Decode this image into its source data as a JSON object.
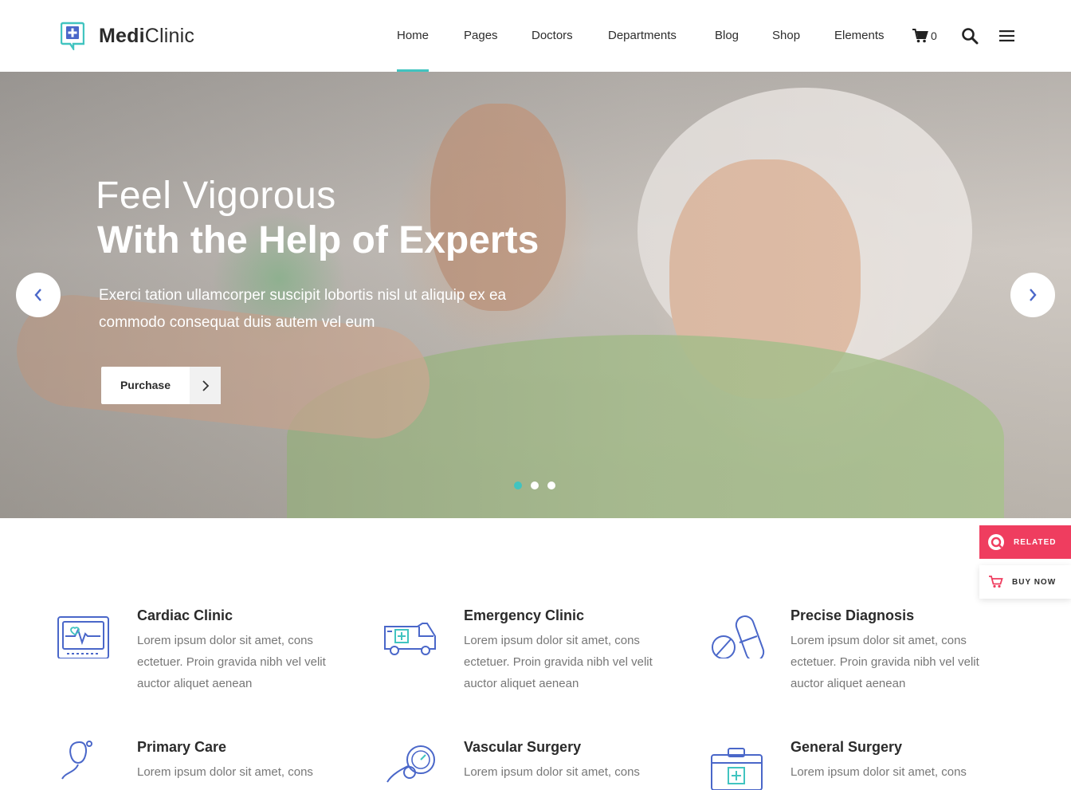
{
  "brand": {
    "name_bold": "Medi",
    "name_rest": "Clinic"
  },
  "nav": {
    "items": [
      {
        "label": "Home"
      },
      {
        "label": "Pages"
      },
      {
        "label": "Doctors"
      },
      {
        "label": "Departments"
      },
      {
        "label": "Blog"
      },
      {
        "label": "Shop"
      },
      {
        "label": "Elements"
      }
    ],
    "cart_count": "0",
    "icons": [
      "cart-icon",
      "search-icon",
      "menu-icon"
    ]
  },
  "hero": {
    "line1": "Feel Vigorous",
    "line2": "With the Help of Experts",
    "description": "Exerci tation ullamcorper suscipit lobortis nisl ut aliquip ex ea commodo consequat duis autem vel eum",
    "button_label": "Purchase",
    "slides_total": 3,
    "active_slide": 1
  },
  "side_widgets": {
    "related_label": "RELATED",
    "buy_now_label": "BUY NOW",
    "accent": "#ef3d5f"
  },
  "features": [
    {
      "title": "Cardiac Clinic",
      "text": "Lorem ipsum dolor sit amet, cons ectetuer. Proin gravida nibh vel velit auctor aliquet aenean",
      "icon": "heart-monitor-icon"
    },
    {
      "title": "Emergency Clinic",
      "text": "Lorem ipsum dolor sit amet, cons ectetuer. Proin gravida nibh vel velit auctor aliquet aenean",
      "icon": "ambulance-icon"
    },
    {
      "title": "Precise Diagnosis",
      "text": "Lorem ipsum dolor sit amet, cons ectetuer. Proin gravida nibh vel velit auctor aliquet aenean",
      "icon": "pills-icon"
    },
    {
      "title": "Primary Care",
      "text": "Lorem ipsum dolor sit amet, cons",
      "icon": "stethoscope-icon"
    },
    {
      "title": "Vascular Surgery",
      "text": "Lorem ipsum dolor sit amet, cons",
      "icon": "blood-pressure-icon"
    },
    {
      "title": "General Surgery",
      "text": "Lorem ipsum dolor sit amet, cons",
      "icon": "first-aid-kit-icon"
    }
  ],
  "colors": {
    "accent": "#41c4c0",
    "icon_blue": "#4a67c9",
    "text_dark": "#2b2b2b",
    "text_muted": "#777777"
  }
}
